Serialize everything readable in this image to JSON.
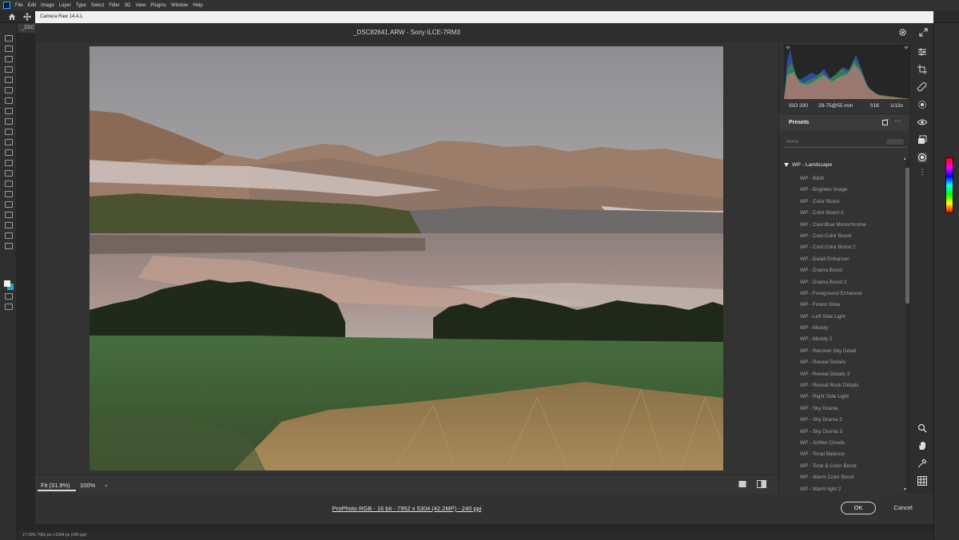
{
  "ps": {
    "menus": [
      "File",
      "Edit",
      "Image",
      "Layer",
      "Type",
      "Select",
      "Filter",
      "3D",
      "View",
      "Plugins",
      "Window",
      "Help"
    ],
    "doc_tab": "_DSC",
    "status": "17.00%     7952 px x 5304 px (240 ppi)"
  },
  "dialog": {
    "title": "Camera Raw 14.4.1",
    "filename": "_DSC82641.ARW  -  Sony ILCE-7RM3",
    "zoom_fit": "Fit (31.9%)",
    "zoom_value": "100%",
    "file_info": "ProPhoto RGB - 16 bit - 7952 x 5304 (42.2MP) - 240 ppi",
    "ok_label": "OK",
    "cancel_label": "Cancel"
  },
  "meta": {
    "iso": "ISO 200",
    "lens": "28-75@55 mm",
    "aperture": "f/16",
    "shutter": "1/13s"
  },
  "presets": {
    "title": "Presets",
    "search_placeholder": "None",
    "group_name": "WP - Landscape",
    "items": [
      "WP - B&W",
      "WP - Brighten Image",
      "WP - Color Boost",
      "WP - Color Boost 2",
      "WP - Cool Blue Monochrome",
      "WP - Cool Color Boost",
      "WP - Cool Color Boost 2",
      "WP - Detail Enhancer",
      "WP - Drama Boost",
      "WP - Drama Boost 2",
      "WP - Foreground Enhancer",
      "WP - Forest Glow",
      "WP - Left Side Light",
      "WP - Moody",
      "WP - Moody 2",
      "WP - Recover Sky Detail",
      "WP - Reveal Details",
      "WP - Reveal Details 2",
      "WP - Reveal Rock Details",
      "WP - Right Side Light",
      "WP - Sky Drama",
      "WP - Sky Drama 2",
      "WP - Sky Drama 3",
      "WP - Soften Clouds",
      "WP - Tonal Balance",
      "WP - Tone & Color Boost",
      "WP - Warm Color Boost",
      "WP - Warm light 2"
    ]
  },
  "icons": [
    "home-icon",
    "move-icon",
    "gear-icon",
    "expand-icon",
    "edit-sliders-icon",
    "crop-icon",
    "heal-icon",
    "mask-icon",
    "redeye-icon",
    "snapshots-icon",
    "presets-icon",
    "more-icon",
    "zoom-icon",
    "hand-icon",
    "sampler-icon",
    "grid-icon"
  ]
}
